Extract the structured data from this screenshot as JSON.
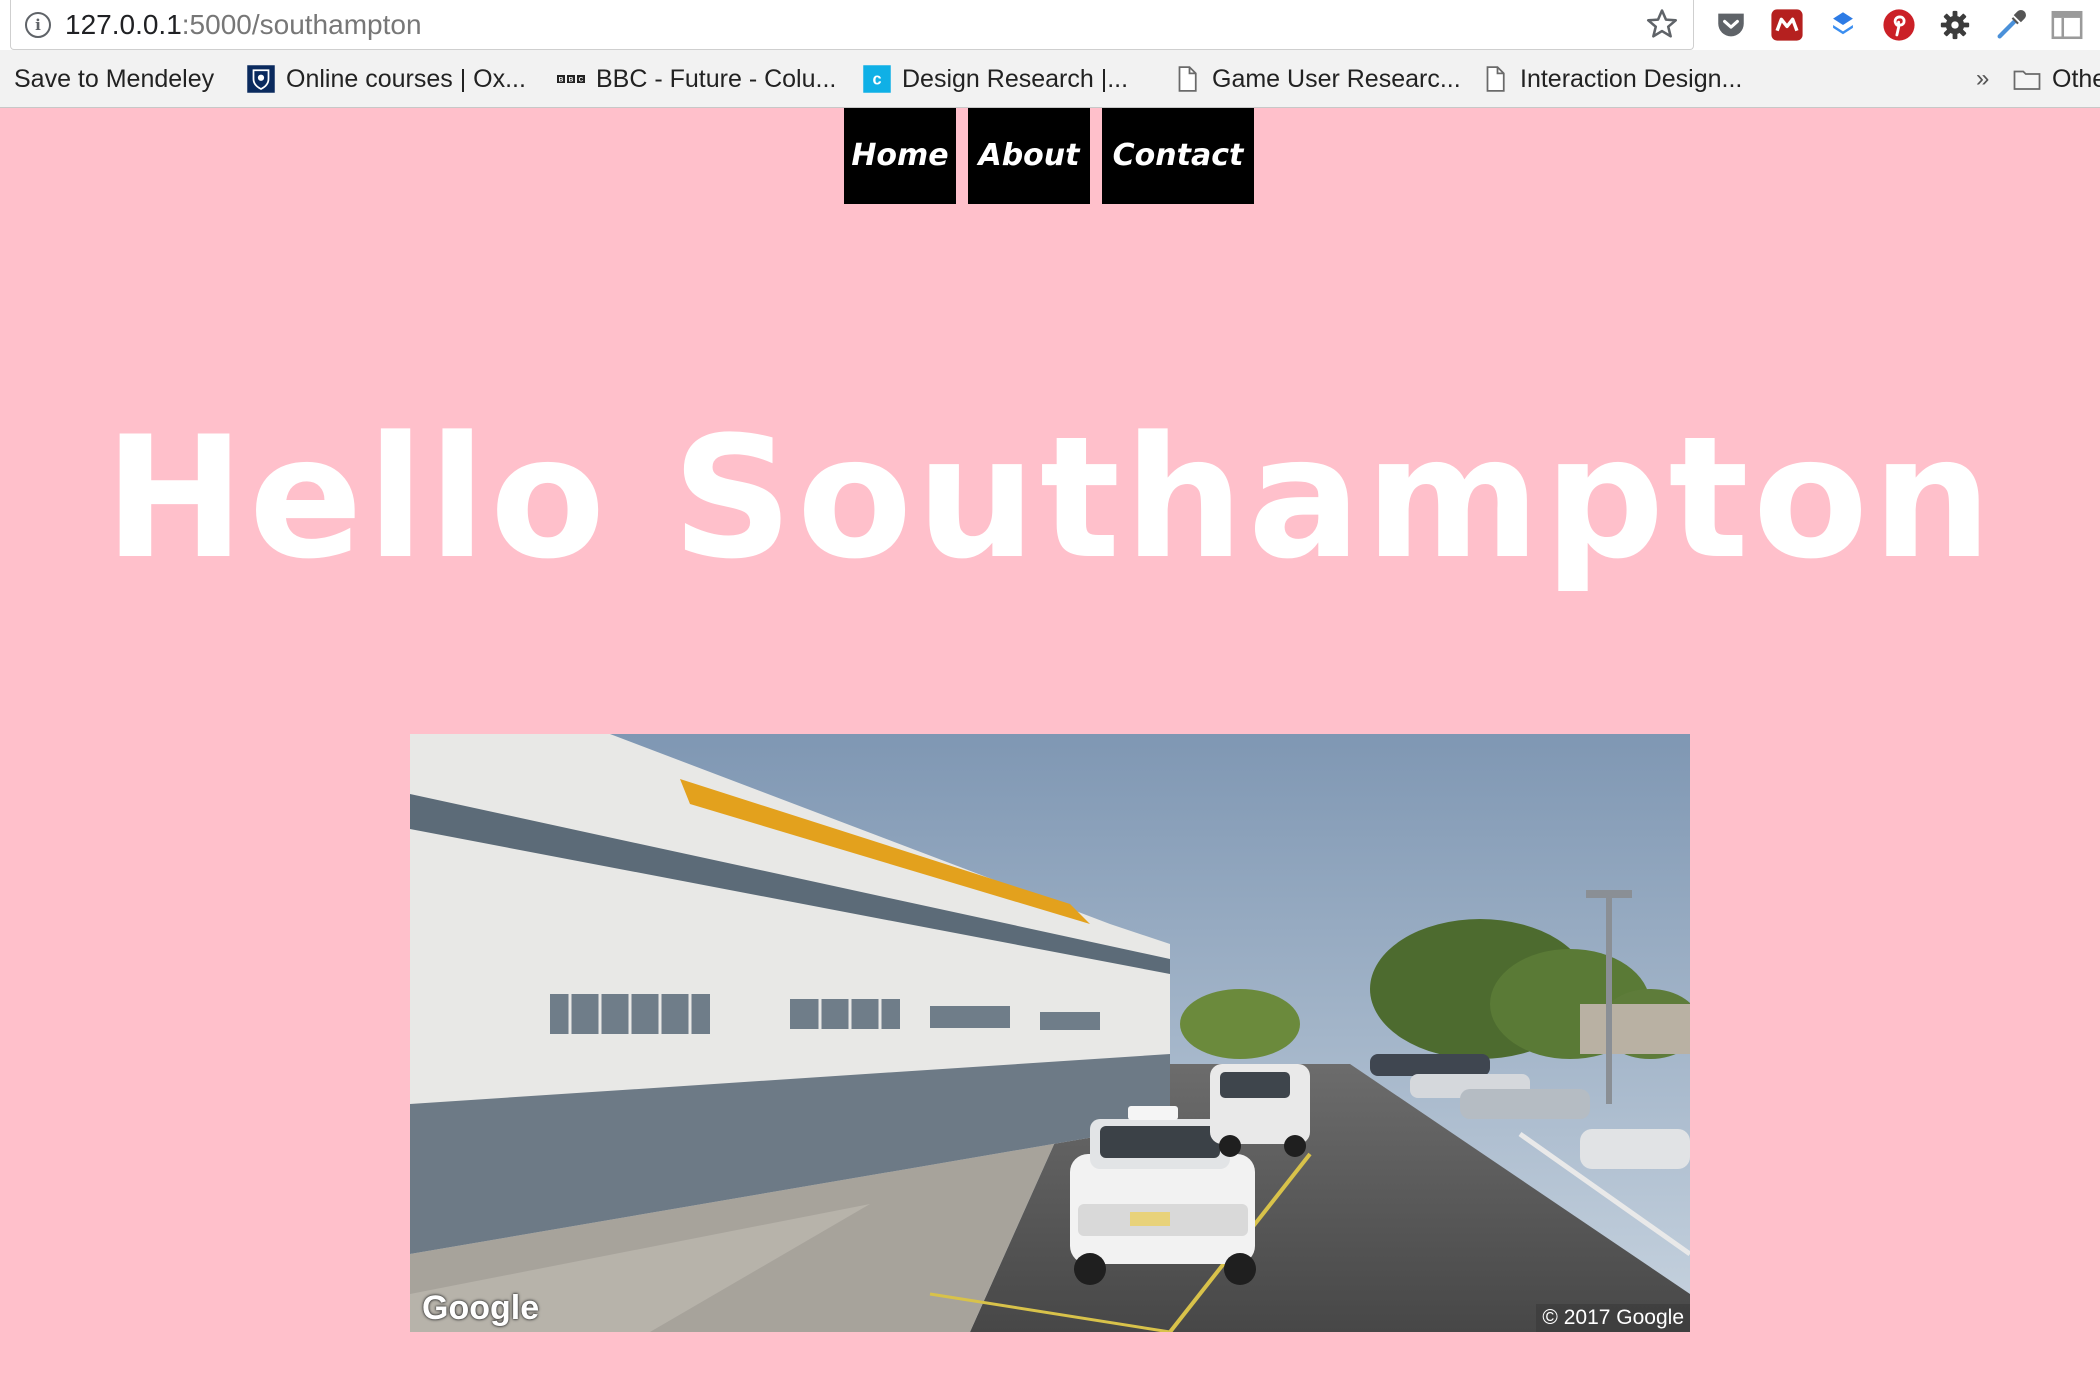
{
  "browser": {
    "url_host": "127.0.0.1",
    "url_rest": ":5000/southampton",
    "icons": [
      "info-icon",
      "star-icon",
      "pocket-icon",
      "mendeley-icon",
      "dropbox-icon",
      "pinterest-icon",
      "gear-icon",
      "eyedropper-icon",
      "panel-icon"
    ],
    "bookmarks": [
      {
        "label": "Save to Mendeley",
        "icon": "none"
      },
      {
        "label": "Online courses | Ox...",
        "icon": "oxford-crest-icon"
      },
      {
        "label": "BBC - Future - Colu...",
        "icon": "bbc-icon"
      },
      {
        "label": "Design Research |...",
        "icon": "c-logo-icon"
      },
      {
        "label": "Game User Researc...",
        "icon": "page-icon"
      },
      {
        "label": "Interaction Design...",
        "icon": "page-icon"
      }
    ],
    "overflow_chevron": "»",
    "other_bookmarks": "Othe"
  },
  "nav": {
    "home": "Home",
    "about": "About",
    "contact": "Contact"
  },
  "page": {
    "title": "Hello Southampton",
    "background": "#ffc0cb",
    "title_color": "#ffffff",
    "nav_bg": "#000000"
  },
  "streetview": {
    "logo": "Google",
    "copyright": "© 2017 Google"
  }
}
